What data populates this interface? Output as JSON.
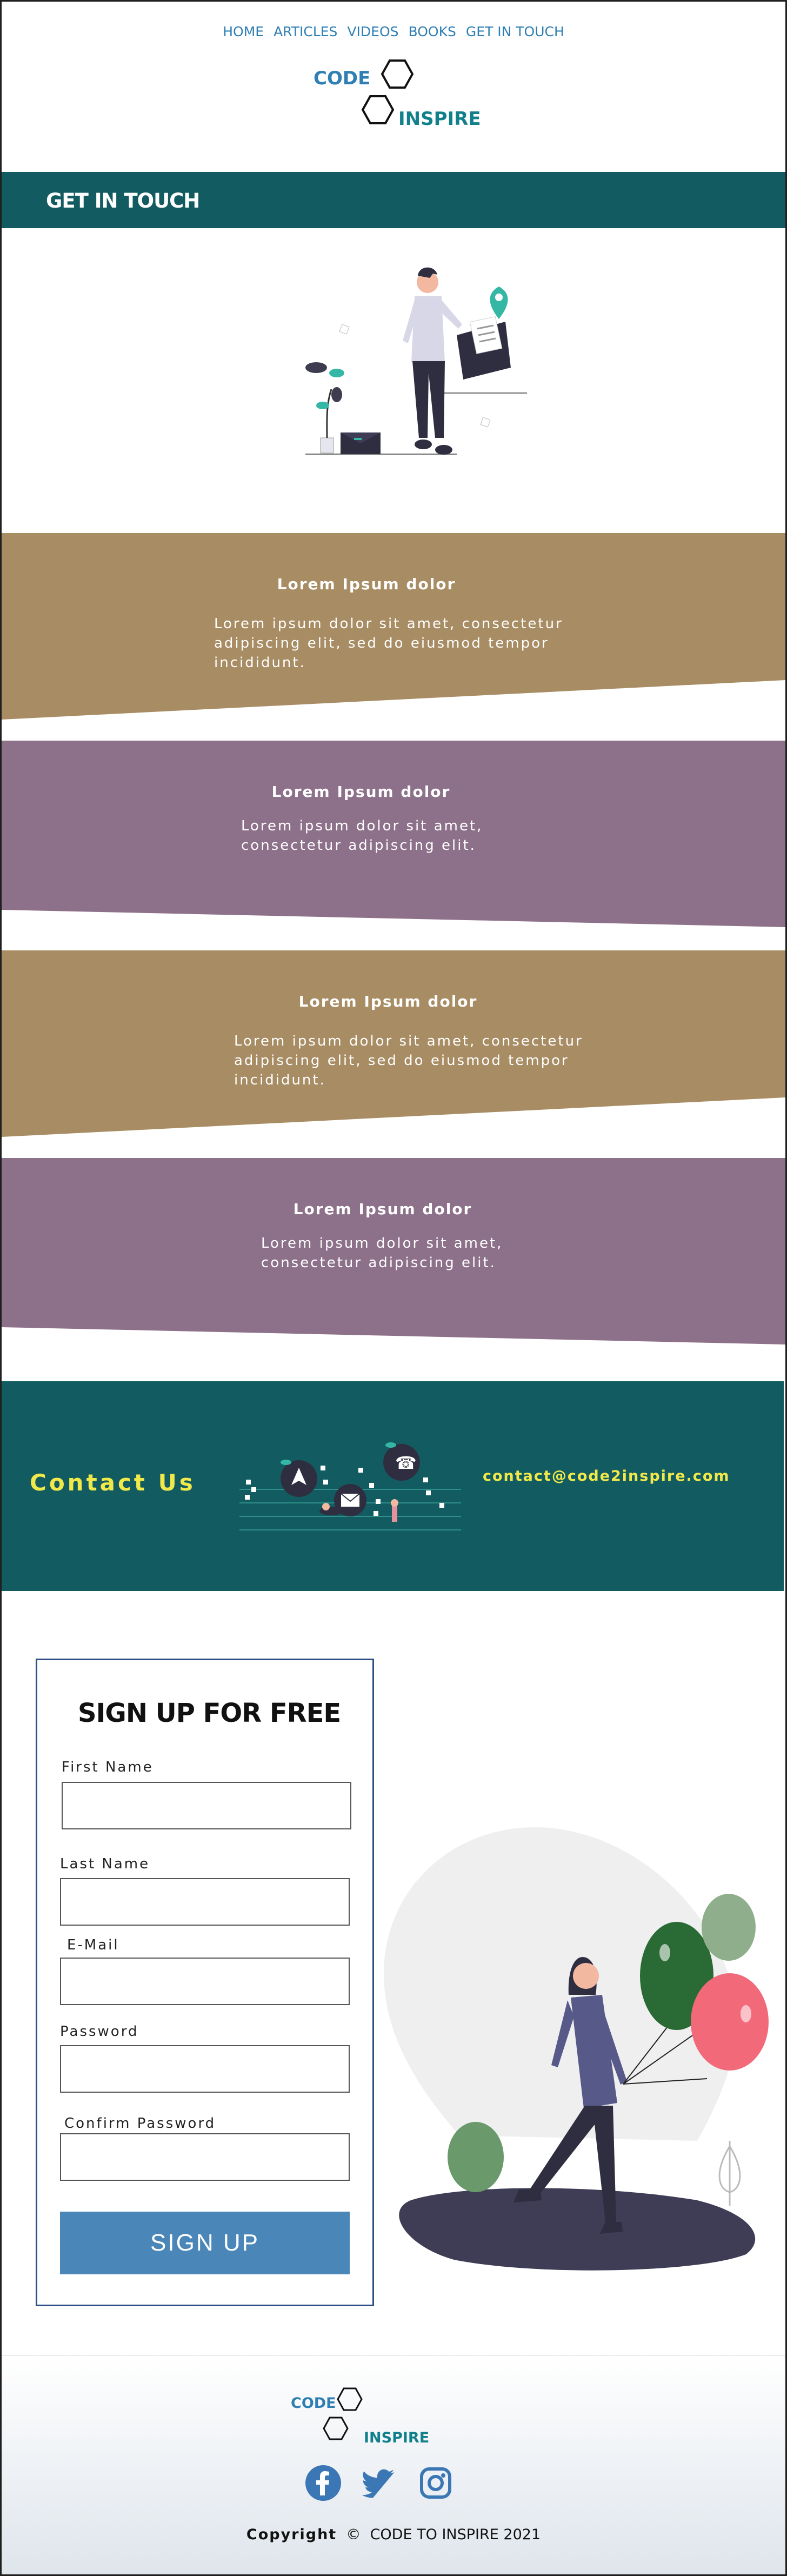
{
  "nav": {
    "items": [
      {
        "label": "HOME"
      },
      {
        "label": "ARTICLES"
      },
      {
        "label": "VIDEOS"
      },
      {
        "label": "BOOKS"
      },
      {
        "label": "GET IN TOUCH"
      }
    ]
  },
  "logo": {
    "code": "CODE",
    "inspire": "INSPIRE"
  },
  "header": {
    "title": "GET IN TOUCH"
  },
  "bands": [
    {
      "title": "Lorem Ipsum dolor",
      "body": "Lorem ipsum dolor sit amet, consectetur adipiscing elit, sed do eiusmod tempor incididunt.",
      "color": "#a88c63"
    },
    {
      "title": "Lorem Ipsum dolor",
      "body": "Lorem ipsum dolor sit amet, consectetur adipiscing elit.",
      "color": "#8d7089"
    },
    {
      "title": "Lorem Ipsum dolor",
      "body": "Lorem ipsum dolor sit amet, consectetur adipiscing elit, sed do eiusmod tempor incididunt.",
      "color": "#a88c63"
    },
    {
      "title": "Lorem Ipsum dolor",
      "body": "Lorem ipsum dolor sit amet, consectetur adipiscing elit.",
      "color": "#8d7089"
    }
  ],
  "contact": {
    "title": "Contact  Us",
    "email": "contact@code2inspire.com",
    "color": "#125c61",
    "accent": "#f1e84a"
  },
  "signup": {
    "heading": "SIGN UP FOR FREE",
    "fields": [
      {
        "label": "First Name",
        "value": "",
        "placeholder": ""
      },
      {
        "label": "Last Name",
        "value": "",
        "placeholder": ""
      },
      {
        "label": "E-Mail",
        "value": "",
        "placeholder": ""
      },
      {
        "label": "Password",
        "value": "",
        "placeholder": ""
      },
      {
        "label": "Confirm Password",
        "value": "",
        "placeholder": ""
      }
    ],
    "button": "SIGN  UP",
    "button_color": "#4a86b8"
  },
  "footer": {
    "logo_code": "CODE",
    "logo_inspire": "INSPIRE",
    "socials": [
      "facebook-icon",
      "twitter-icon",
      "instagram-icon"
    ],
    "copyright_bold": "Copyright",
    "copyright_rest": "CODE TO INSPIRE  2021"
  }
}
